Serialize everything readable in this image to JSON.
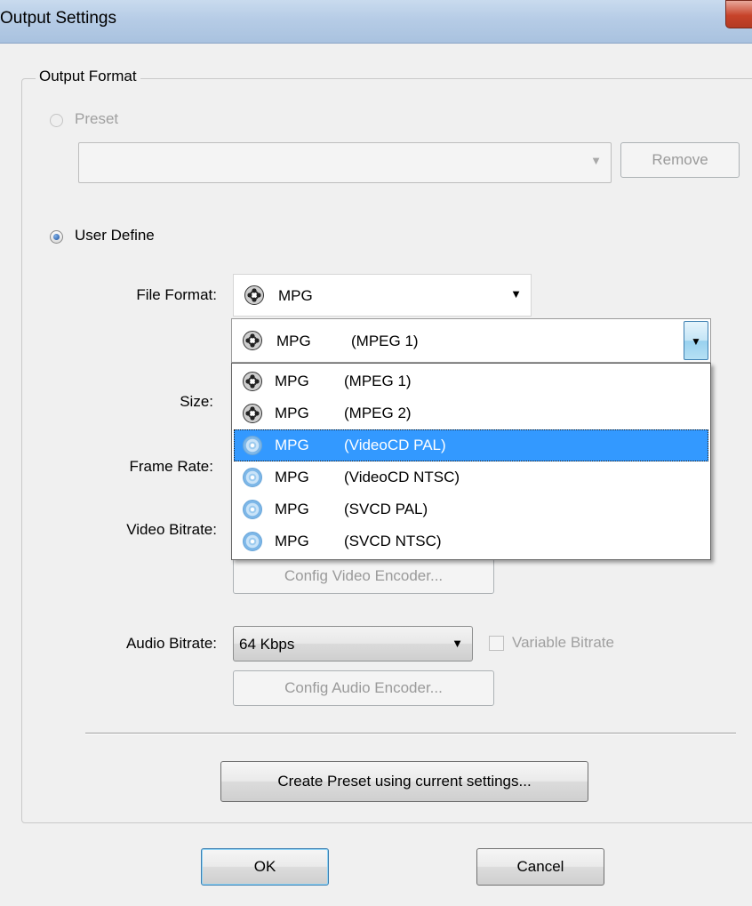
{
  "window": {
    "title": "Output Settings"
  },
  "group": {
    "label": "Output Format"
  },
  "preset": {
    "radio_label": "Preset",
    "combo_value": "",
    "remove_label": "Remove"
  },
  "user_define": {
    "radio_label": "User Define"
  },
  "labels": {
    "file_format": "File Format:",
    "size": "Size:",
    "frame_rate": "Frame Rate:",
    "video_bitrate": "Video Bitrate:",
    "audio_bitrate": "Audio Bitrate:"
  },
  "file_format": {
    "name": "MPG",
    "icon": "film-reel-icon"
  },
  "sub_format": {
    "name": "MPG",
    "variant": "(MPEG 1)",
    "icon": "film-reel-icon"
  },
  "sub_format_options": [
    {
      "name": "MPG",
      "variant": "(MPEG 1)",
      "icon": "film-reel-icon",
      "selected": false
    },
    {
      "name": "MPG",
      "variant": "(MPEG 2)",
      "icon": "film-reel-icon",
      "selected": false
    },
    {
      "name": "MPG",
      "variant": "(VideoCD PAL)",
      "icon": "cd-icon",
      "selected": true
    },
    {
      "name": "MPG",
      "variant": "(VideoCD NTSC)",
      "icon": "cd-icon",
      "selected": false
    },
    {
      "name": "MPG",
      "variant": "(SVCD PAL)",
      "icon": "cd-icon",
      "selected": false
    },
    {
      "name": "MPG",
      "variant": "(SVCD NTSC)",
      "icon": "cd-icon",
      "selected": false
    }
  ],
  "buttons": {
    "config_video": "Config Video Encoder...",
    "config_audio": "Config Audio Encoder...",
    "create_preset": "Create Preset using current settings...",
    "ok": "OK",
    "cancel": "Cancel"
  },
  "audio_bitrate": {
    "value": "64 Kbps"
  },
  "variable_bitrate": {
    "label": "Variable Bitrate",
    "checked": false
  },
  "colors": {
    "selection": "#3399ff",
    "titlebar": "#b6cce6"
  }
}
